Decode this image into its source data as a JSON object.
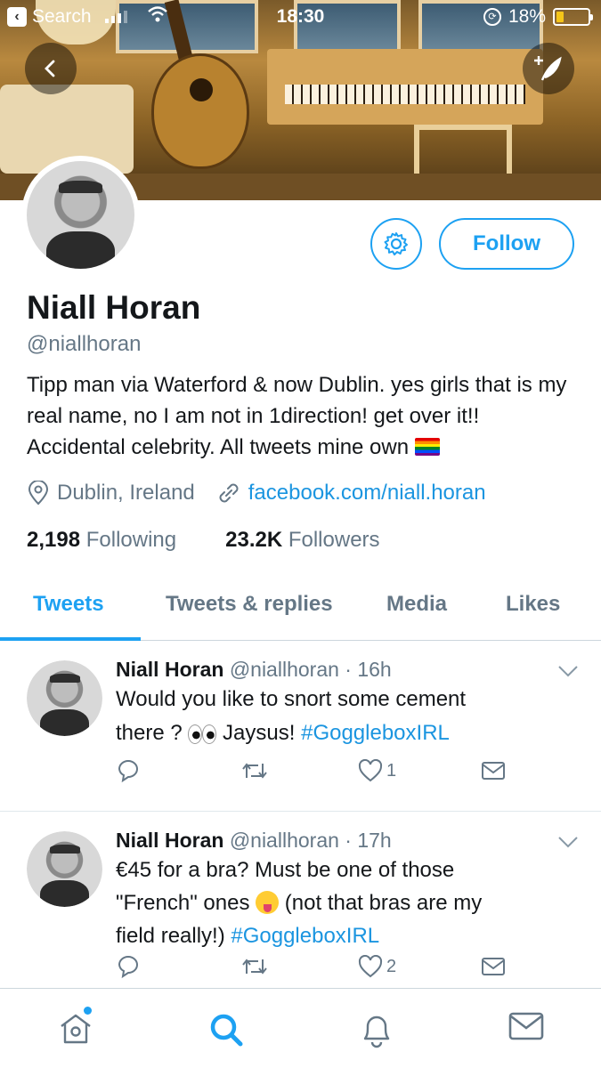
{
  "status_bar": {
    "back_app": "Search",
    "time": "18:30",
    "battery": "18%"
  },
  "profile": {
    "name": "Niall Horan",
    "handle": "@niallhoran",
    "bio": "Tipp man via Waterford & now Dublin. yes girls that is my real name, no I am not in 1direction! get over it!! Accidental celebrity. All tweets mine own",
    "location": "Dublin, Ireland",
    "link": "facebook.com/niall.horan",
    "following_count": "2,198",
    "following_label": "Following",
    "followers_count": "23.2K",
    "followers_label": "Followers",
    "follow_button": "Follow"
  },
  "tabs": [
    "Tweets",
    "Tweets & replies",
    "Media",
    "Likes"
  ],
  "tweets": [
    {
      "name": "Niall Horan",
      "handle": "@niallhoran",
      "time": "· 16h",
      "text_1": "Would you like to snort some cement",
      "text_2": "there ? ",
      "text_3": " Jaysus! ",
      "hashtag": "#GoggleboxIRL",
      "likes": "1"
    },
    {
      "name": "Niall Horan",
      "handle": "@niallhoran",
      "time": "· 17h",
      "text_1": "€45 for a bra? Must be one of those",
      "text_2": "\"French\" ones ",
      "text_3": " (not that bras are my",
      "text_4": "field really!) ",
      "hashtag": "#GoggleboxIRL",
      "likes": "2"
    }
  ],
  "colors": {
    "accent": "#1da1f2",
    "text": "#14171a",
    "secondary": "#657786"
  },
  "icons": [
    "back-icon",
    "compose-icon",
    "gear-icon",
    "location-icon",
    "link-icon",
    "reply-icon",
    "retweet-icon",
    "like-icon",
    "dm-icon",
    "chevron-down-icon",
    "home-icon",
    "search-icon",
    "notifications-icon",
    "messages-icon"
  ]
}
